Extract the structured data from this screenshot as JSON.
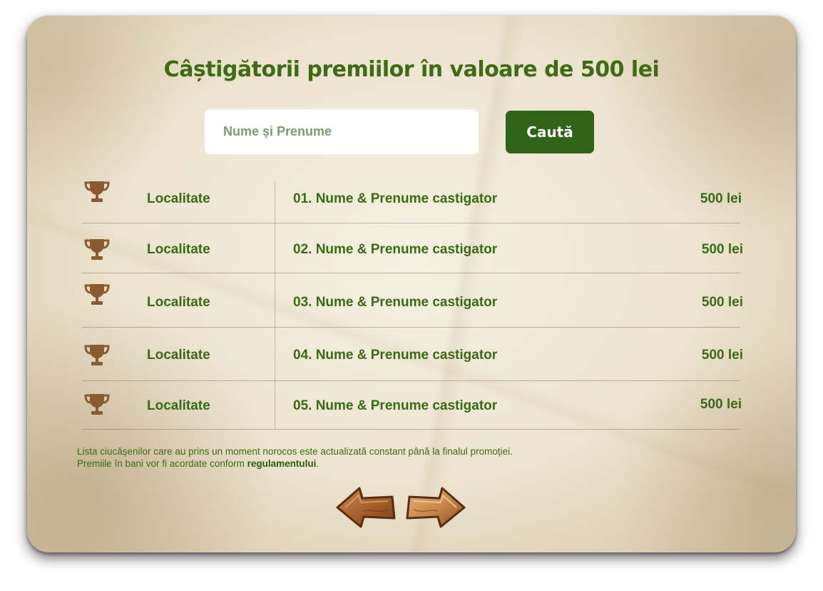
{
  "page": {
    "title": "Câștigătorii premiilor în valoare de 500 lei"
  },
  "search": {
    "placeholder": "Nume și Prenume",
    "button_label": "Caută"
  },
  "rows": [
    {
      "icon": "trophy-icon",
      "locality": "Localitate",
      "name": "01. Nume & Prenume castigator",
      "amount": "500 lei"
    },
    {
      "icon": "trophy-icon",
      "locality": "Localitate",
      "name": "02. Nume & Prenume castigator",
      "amount": "500 lei"
    },
    {
      "icon": "trophy-icon",
      "locality": "Localitate",
      "name": "03. Nume & Prenume castigator",
      "amount": "500 lei"
    },
    {
      "icon": "trophy-icon",
      "locality": "Localitate",
      "name": "04. Nume & Prenume castigator",
      "amount": "500 lei"
    },
    {
      "icon": "trophy-icon",
      "locality": "Localitate",
      "name": "05. Nume & Prenume castigator",
      "amount": "500 lei"
    }
  ],
  "footer": {
    "line1": "Lista ciucășenilor care au prins un moment norocos este  actualizată constant până la finalul promoției.",
    "line2_prefix": "Premiile în bani vor fi acordate conform ",
    "line2_link": "regulamentului",
    "line2_suffix": "."
  },
  "pagination": {
    "prev_icon": "wooden-arrow-left-icon",
    "next_icon": "wooden-arrow-right-icon"
  },
  "colors": {
    "brand_green": "#2f6317",
    "text_green": "#3b6a17",
    "trophy_brown": "#8a5a30",
    "paper": "#e9dfc6"
  }
}
